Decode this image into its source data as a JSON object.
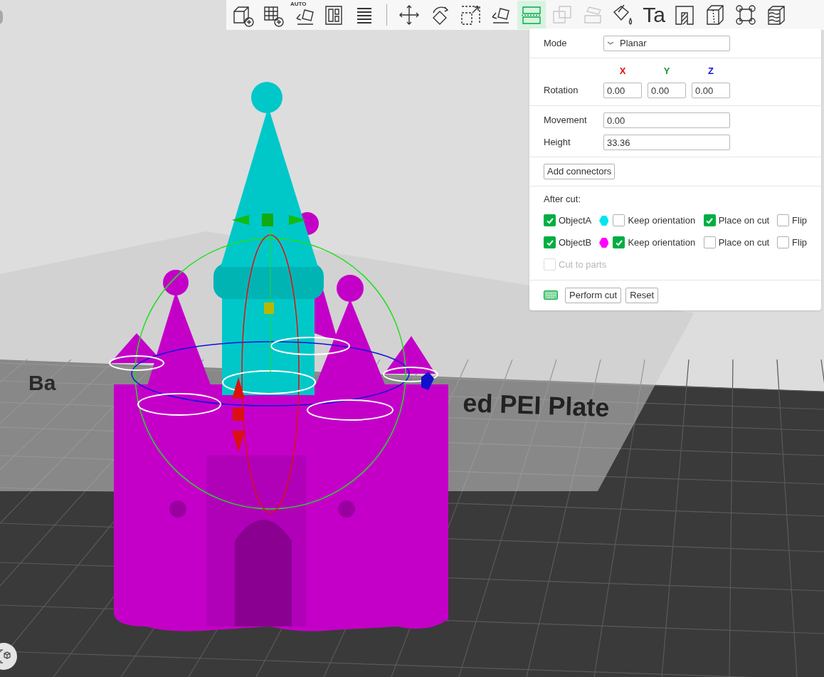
{
  "toolbar": {
    "tools": [
      {
        "selected": false,
        "disabled": false
      },
      {
        "selected": false,
        "disabled": false
      },
      {
        "selected": false,
        "disabled": false,
        "caption": "AUTO"
      },
      {
        "selected": false,
        "disabled": false
      },
      {
        "selected": false,
        "disabled": false
      },
      {
        "selected": false,
        "disabled": false
      },
      {
        "selected": false,
        "disabled": false
      },
      {
        "selected": false,
        "disabled": false
      },
      {
        "selected": false,
        "disabled": false
      },
      {
        "selected": true,
        "disabled": false
      },
      {
        "selected": false,
        "disabled": true
      },
      {
        "selected": false,
        "disabled": true
      },
      {
        "selected": false,
        "disabled": false
      },
      {
        "selected": false,
        "disabled": false,
        "caption": "Ta"
      },
      {
        "selected": false,
        "disabled": false
      },
      {
        "selected": false,
        "disabled": false
      },
      {
        "selected": false,
        "disabled": false
      },
      {
        "selected": false,
        "disabled": false
      }
    ]
  },
  "plate_labels": [
    "Ba",
    "ed PEI Plate"
  ],
  "cut_panel": {
    "mode": {
      "label": "Mode",
      "value": "Planar"
    },
    "axes": [
      {
        "label": "X",
        "color": "#e01010"
      },
      {
        "label": "Y",
        "color": "#1a9a3a"
      },
      {
        "label": "Z",
        "color": "#1010e0"
      }
    ],
    "rotation": {
      "label": "Rotation",
      "values": [
        "0.00",
        "0.00",
        "0.00"
      ]
    },
    "movement": {
      "label": "Movement",
      "value": "0.00"
    },
    "height": {
      "label": "Height",
      "value": "33.36"
    },
    "add_connectors": "Add connectors",
    "after_cut": "After cut:",
    "objects": [
      {
        "name": "ObjectA",
        "checked": true,
        "color": "#00e5ee",
        "options": [
          {
            "label": "Keep orientation",
            "checked": false
          },
          {
            "label": "Place on cut",
            "checked": true
          },
          {
            "label": "Flip",
            "checked": false
          }
        ]
      },
      {
        "name": "ObjectB",
        "checked": true,
        "color": "#ff00ff",
        "options": [
          {
            "label": "Keep orientation",
            "checked": true
          },
          {
            "label": "Place on cut",
            "checked": false
          },
          {
            "label": "Flip",
            "checked": false
          }
        ]
      }
    ],
    "cut_to_parts": {
      "label": "Cut to parts",
      "checked": false,
      "disabled": true
    },
    "buttons": [
      "Perform cut",
      "Reset"
    ]
  }
}
